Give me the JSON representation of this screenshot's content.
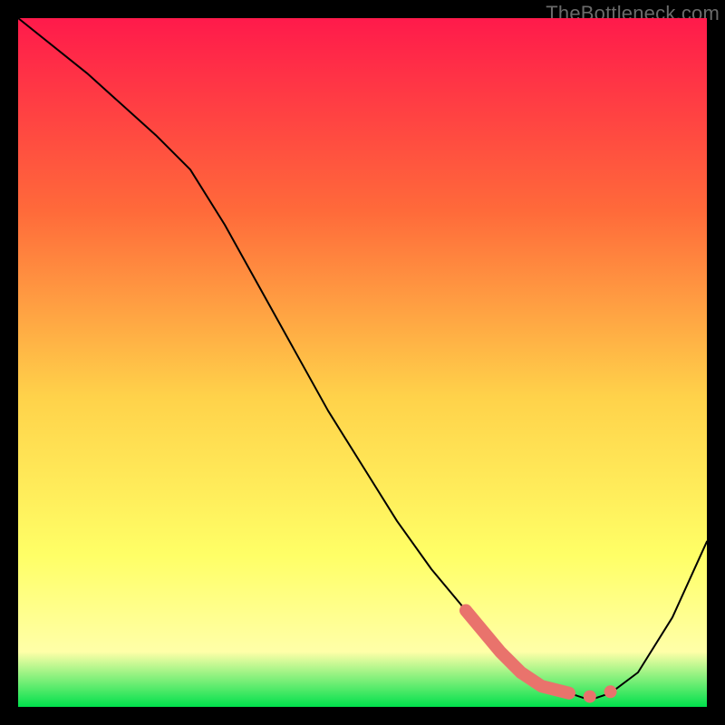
{
  "watermark": "TheBottleneck.com",
  "colors": {
    "background": "#000000",
    "gradient_top": "#ff1a4b",
    "gradient_mid_upper": "#ff6a3a",
    "gradient_mid": "#ffd24a",
    "gradient_mid_lower": "#ffff66",
    "gradient_lower": "#ffffa8",
    "gradient_bottom": "#00e04c",
    "curve": "#000000",
    "highlight": "#e9736c"
  },
  "chart_data": {
    "type": "line",
    "title": "",
    "xlabel": "",
    "ylabel": "",
    "xlim": [
      0,
      100
    ],
    "ylim": [
      0,
      100
    ],
    "grid": false,
    "series": [
      {
        "name": "bottleneck-curve",
        "x": [
          0,
          10,
          20,
          25,
          30,
          35,
          40,
          45,
          50,
          55,
          60,
          65,
          70,
          73,
          76,
          80,
          83,
          86,
          90,
          95,
          100
        ],
        "y": [
          100,
          92,
          83,
          78,
          70,
          61,
          52,
          43,
          35,
          27,
          20,
          14,
          8,
          5,
          3,
          2,
          1,
          2,
          5,
          13,
          24
        ]
      }
    ],
    "highlight_segment": {
      "name": "optimal-region-main",
      "x": [
        65,
        70,
        73,
        76,
        80
      ],
      "y": [
        14,
        8,
        5,
        3,
        2
      ]
    },
    "highlight_points": [
      {
        "name": "optimal-point-1",
        "x": 83,
        "y": 1.5
      },
      {
        "name": "optimal-point-2",
        "x": 86,
        "y": 2.2
      }
    ]
  }
}
